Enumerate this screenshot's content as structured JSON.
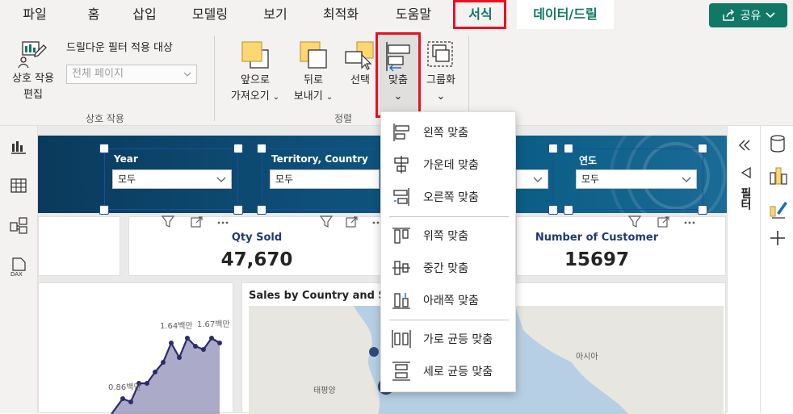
{
  "menubar": {
    "tabs": [
      {
        "label": "파일"
      },
      {
        "label": "홈"
      },
      {
        "label": "삽입"
      },
      {
        "label": "모델링"
      },
      {
        "label": "보기"
      },
      {
        "label": "최적화"
      },
      {
        "label": "도움말"
      },
      {
        "label": "서식",
        "active": true
      },
      {
        "label": "데이터/드릴",
        "active": true
      }
    ],
    "share_label": "공유"
  },
  "ribbon": {
    "interaction_edit_label": "상호 작용\n편집",
    "interaction_edit_line1": "상호 작용",
    "interaction_edit_line2": "편집",
    "drilldown_filter_label": "드릴다운 필터 적용 대상",
    "drilldown_select_value": "전체 페이지",
    "group_interaction": "상호 작용",
    "bring_forward_line1": "앞으로",
    "bring_forward_line2": "가져오기",
    "send_backward_line1": "뒤로",
    "send_backward_line2": "보내기",
    "select_label": "선택",
    "align_label": "맞춤",
    "group_label": "그룹화",
    "group_arrange": "정렬"
  },
  "canvas": {
    "slicers": [
      {
        "title": "Year",
        "value": "모두"
      },
      {
        "title": "Territory, Country",
        "value": "모두"
      },
      {
        "title": "연도",
        "value": "모두"
      }
    ],
    "cards": [
      {
        "title": "Qty Sold",
        "value": "47,670"
      },
      {
        "title": "Number of Customer",
        "value": "15697"
      }
    ],
    "map_title": "Sales by Country and Sub",
    "map_labels": [
      "아시아",
      "태평양"
    ],
    "line_labels": [
      "1.64백만",
      "1.67백만",
      "0.86백만"
    ]
  },
  "dropdown": {
    "items": [
      {
        "label": "왼쪽 맞춤",
        "icon": "align-left-icon"
      },
      {
        "label": "가운데 맞춤",
        "icon": "align-center-icon"
      },
      {
        "label": "오른쪽 맞춤",
        "icon": "align-right-icon"
      },
      {
        "label": "위쪽 맞춤",
        "icon": "align-top-icon"
      },
      {
        "label": "중간 맞춤",
        "icon": "align-middle-icon"
      },
      {
        "label": "아래쪽 맞춤",
        "icon": "align-bottom-icon"
      },
      {
        "label": "가로 균등 맞춤",
        "icon": "distribute-horizontal-icon"
      },
      {
        "label": "세로 균등 맞춤",
        "icon": "distribute-vertical-icon"
      }
    ]
  },
  "right_panel": {
    "filter_label": "필터"
  },
  "colors": {
    "accent": "#117865",
    "highlight": "#e81123",
    "banner": "#0e4f78"
  }
}
